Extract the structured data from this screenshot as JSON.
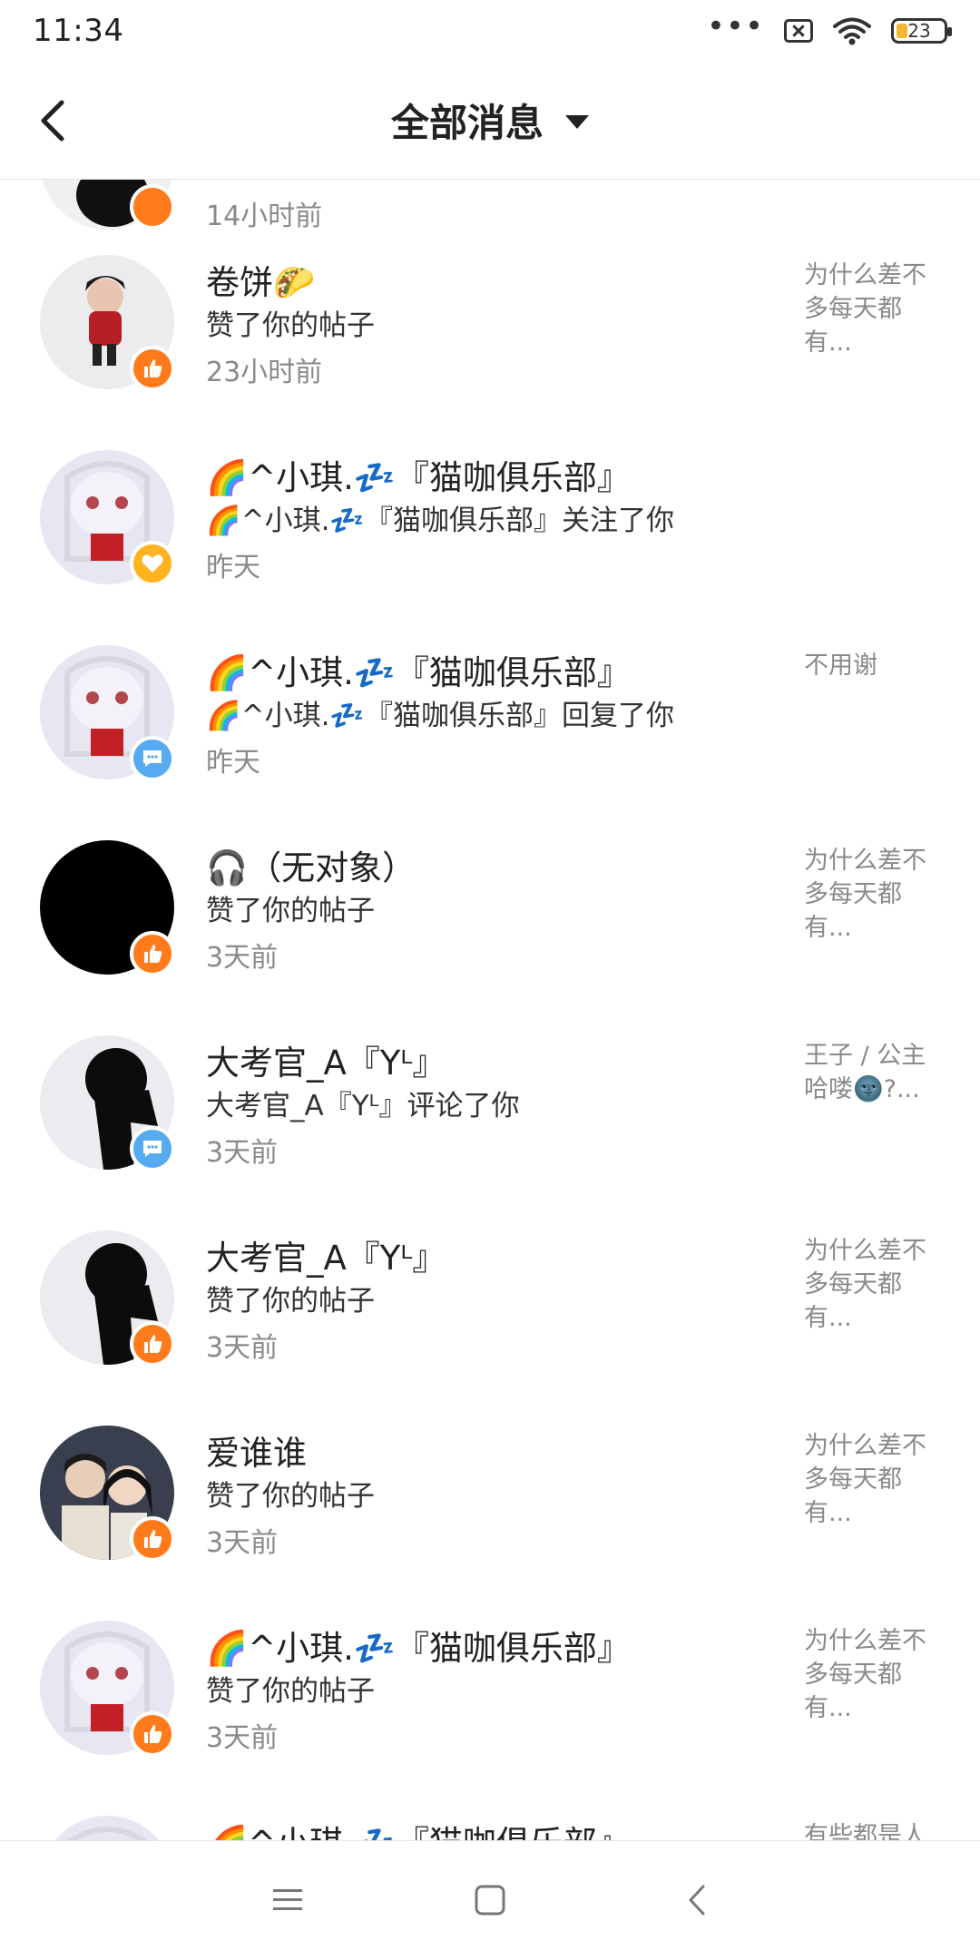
{
  "status_bar": {
    "time": "11:34",
    "more": "•••",
    "battery": "23"
  },
  "header": {
    "title": "全部消息"
  },
  "partial_top": {
    "time": "14小时前"
  },
  "messages": [
    {
      "name": "卷饼🌮",
      "action": "赞了你的帖子",
      "time": "23小时前",
      "preview": "为什么差不多每天都有...",
      "badge": "like"
    },
    {
      "name": "🌈^小琪.💤『猫咖俱乐部』",
      "action": "🌈^小琪.💤『猫咖俱乐部』关注了你",
      "time": "昨天",
      "preview": "",
      "badge": "follow"
    },
    {
      "name": "🌈^小琪.💤『猫咖俱乐部』",
      "action": "🌈^小琪.💤『猫咖俱乐部』回复了你",
      "time": "昨天",
      "preview": "不用谢",
      "badge": "reply"
    },
    {
      "name": "🎧（无对象）",
      "action": "赞了你的帖子",
      "time": "3天前",
      "preview": "为什么差不多每天都有...",
      "badge": "like"
    },
    {
      "name": "大考官_A『Yᴸ』",
      "action": "大考官_A『Yᴸ』评论了你",
      "time": "3天前",
      "preview": "王子 / 公主哈喽🌚?...",
      "badge": "reply"
    },
    {
      "name": "大考官_A『Yᴸ』",
      "action": "赞了你的帖子",
      "time": "3天前",
      "preview": "为什么差不多每天都有...",
      "badge": "like"
    },
    {
      "name": "爱谁谁",
      "action": "赞了你的帖子",
      "time": "3天前",
      "preview": "为什么差不多每天都有...",
      "badge": "like"
    },
    {
      "name": "🌈^小琪.💤『猫咖俱乐部』",
      "action": "赞了你的帖子",
      "time": "3天前",
      "preview": "为什么差不多每天都有...",
      "badge": "like"
    }
  ],
  "partial_bottom": {
    "name": "🌈^小琪.💤『猫咖俱乐部』",
    "preview": "有些都是人"
  },
  "colors": {
    "like": "#ff7a1a",
    "follow": "#ffb320",
    "reply": "#55aaf0"
  }
}
